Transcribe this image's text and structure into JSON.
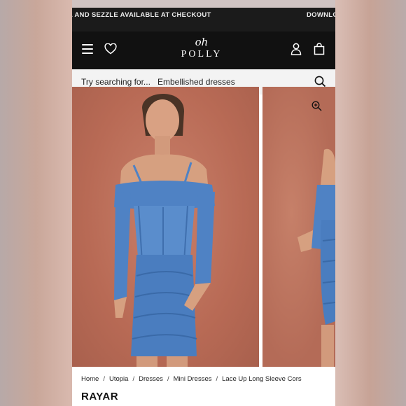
{
  "ticker": {
    "left_text": "A AND SEZZLE AVAILABLE AT CHECKOUT",
    "right_text": "DOWNLO"
  },
  "header": {
    "logo_top": "oh",
    "logo_bottom": "POLLY"
  },
  "search": {
    "prefix": "Try searching for...",
    "term": "Embellished dresses"
  },
  "breadcrumb": [
    "Home",
    "Utopia",
    "Dresses",
    "Mini Dresses",
    "Lace Up Long Sleeve Cors"
  ],
  "product": {
    "title": "RAYAR"
  },
  "colors": {
    "header_bg": "#111111",
    "dress_blue": "#4f82c4",
    "backdrop": "#b86a55"
  }
}
